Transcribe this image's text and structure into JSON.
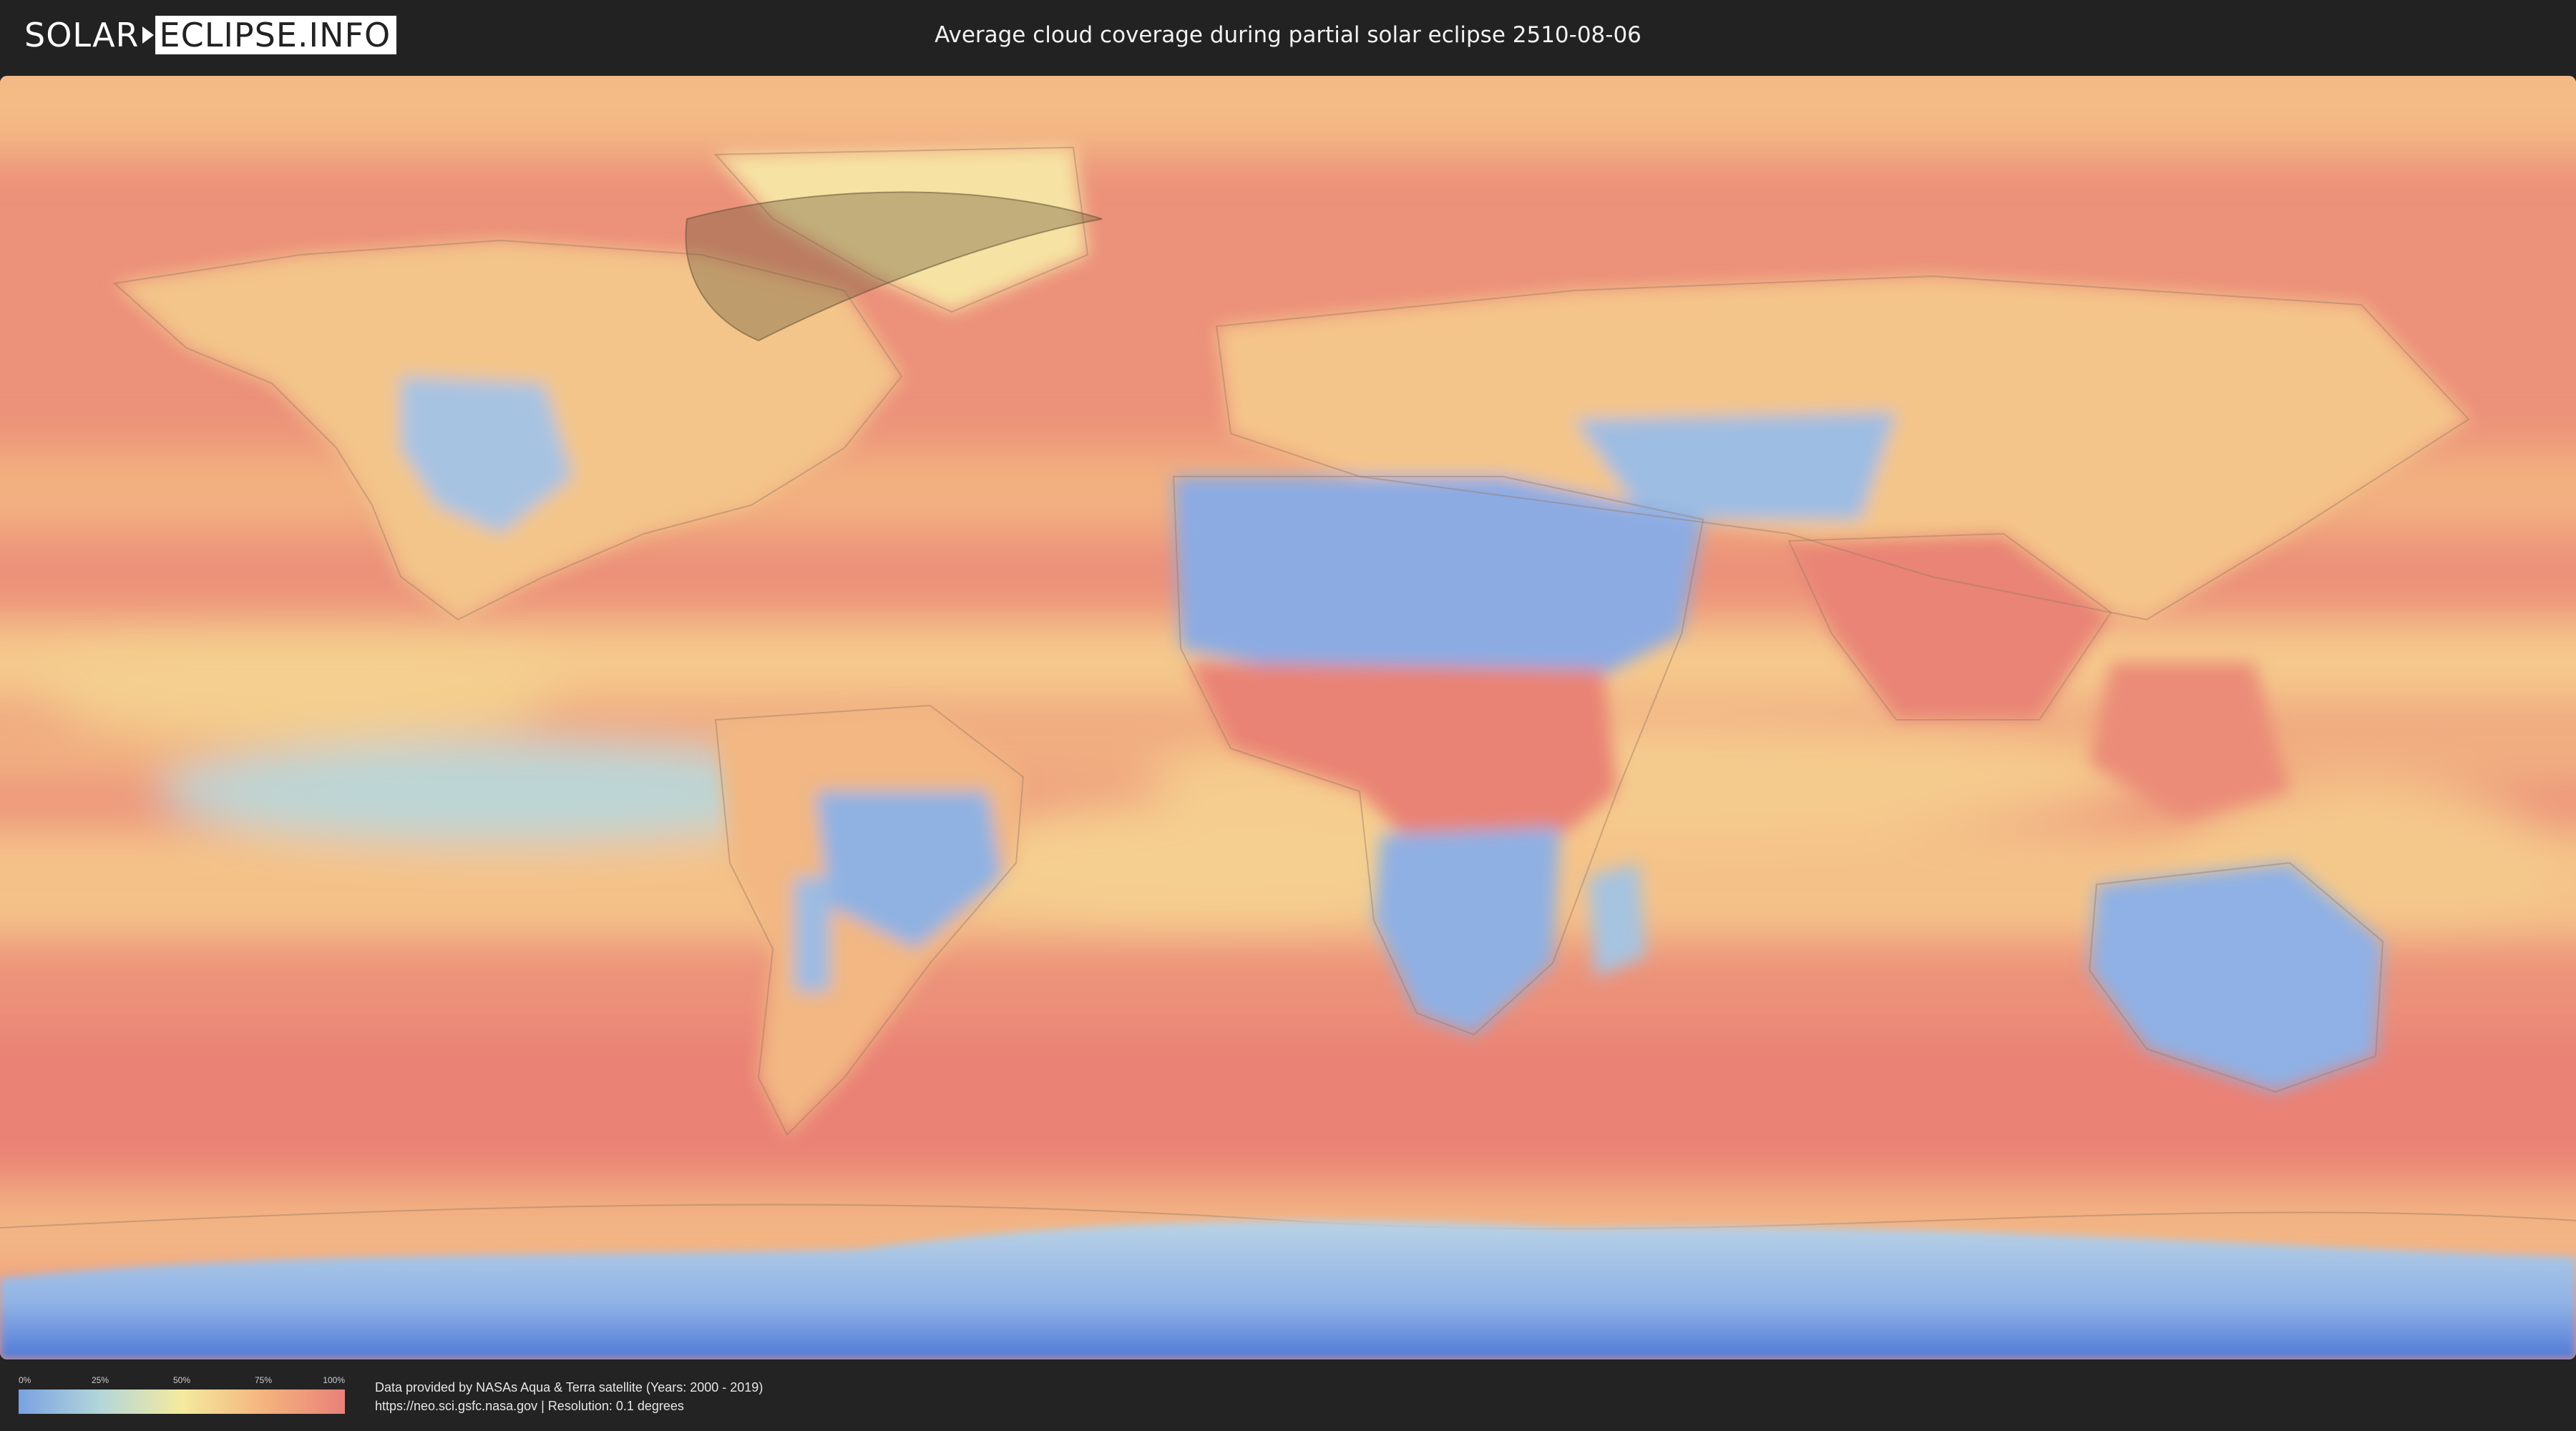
{
  "header": {
    "logo_left": "SOLAR",
    "logo_right": "ECLIPSE.INFO",
    "title": "Average cloud coverage during partial solar eclipse 2510-08-06"
  },
  "legend": {
    "ticks": [
      "0%",
      "25%",
      "50%",
      "75%",
      "100%"
    ],
    "colors": [
      "#7aa2e2",
      "#b3d6da",
      "#f4ea9e",
      "#f4b47d",
      "#e98079"
    ]
  },
  "credits": {
    "line1": "Data provided by NASAs Aqua & Terra satellite (Years: 2000 - 2019)",
    "line2": "https://neo.sci.gsfc.nasa.gov | Resolution: 0.1 degrees"
  },
  "map": {
    "layer": "cloud-coverage",
    "eclipse_zone_color": "#6b5a3a"
  }
}
